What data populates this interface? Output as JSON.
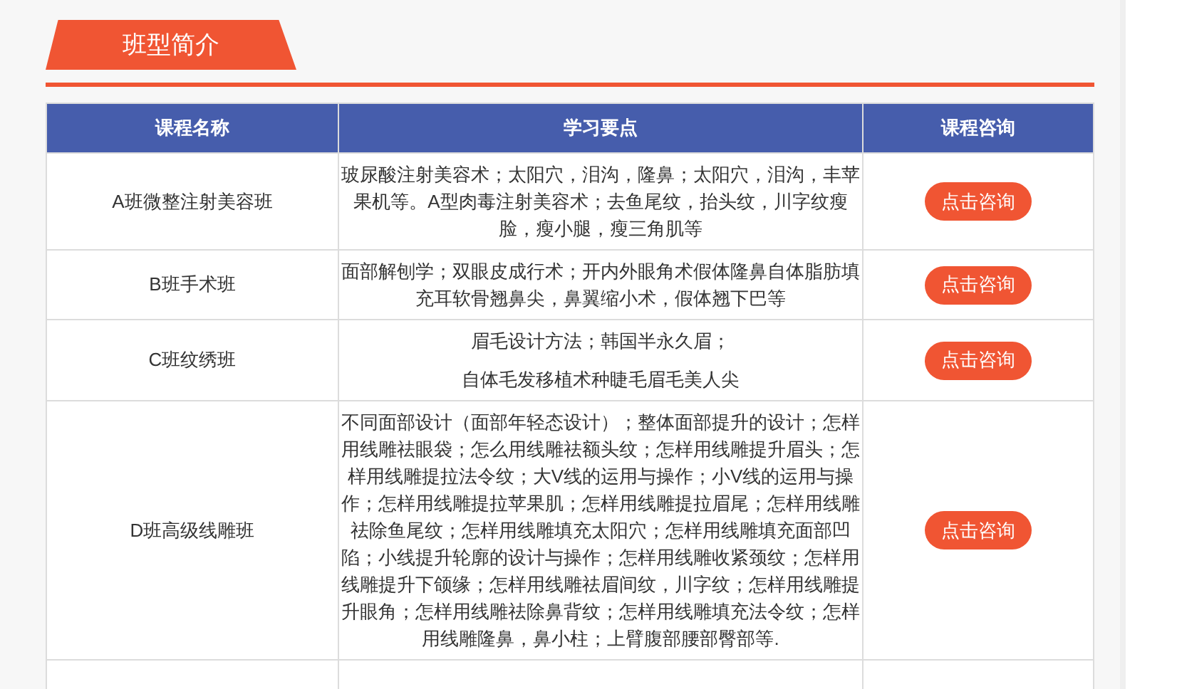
{
  "section_tab": {
    "title": "班型简介"
  },
  "table": {
    "columns": [
      "课程名称",
      "学习要点",
      "课程咨询"
    ],
    "rows": [
      {
        "name": "A班微整注射美容班",
        "points": [
          "玻尿酸注射美容术；太阳穴，泪沟，隆鼻；太阳穴，泪沟，丰苹果机等。A型肉毒注射美容术；去鱼尾纹，抬头纹，川字纹瘦脸，瘦小腿，瘦三角肌等"
        ],
        "button": "点击咨询"
      },
      {
        "name": "B班手术班",
        "points": [
          "面部解刨学；双眼皮成行术；开内外眼角术假体隆鼻自体脂肪填充耳软骨翘鼻尖，鼻翼缩小术，假体翘下巴等"
        ],
        "button": "点击咨询"
      },
      {
        "name": "C班纹绣班",
        "points": [
          "眉毛设计方法；韩国半永久眉；",
          "自体毛发移植术种睫毛眉毛美人尖"
        ],
        "button": "点击咨询"
      },
      {
        "name": "D班高级线雕班",
        "points": [
          "不同面部设计（面部年轻态设计）；整体面部提升的设计；怎样用线雕祛眼袋；怎么用线雕祛额头纹；怎样用线雕提升眉头；怎样用线雕提拉法令纹；大V线的运用与操作；小V线的运用与操作；怎样用线雕提拉苹果肌；怎样用线雕提拉眉尾；怎样用线雕祛除鱼尾纹；怎样用线雕填充太阳穴；怎样用线雕填充面部凹陷；小线提升轮廓的设计与操作；怎样用线雕收紧颈纹；怎样用线雕提升下颌缘；怎样用线雕祛眉间纹，川字纹；怎样用线雕提升眼角；怎样用线雕祛除鼻背纹；怎样用线雕填充法令纹；怎样用线雕隆鼻，鼻小柱；上臂腹部腰部臀部等."
        ],
        "button": "点击咨询"
      }
    ]
  }
}
